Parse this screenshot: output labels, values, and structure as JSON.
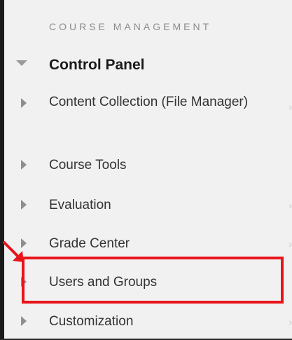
{
  "sidebar": {
    "section_heading": "COURSE MANAGEMENT",
    "control_panel_label": "Control Panel",
    "items": [
      {
        "label": "Content Collection (File Manager)",
        "has_chevron": true
      },
      {
        "label": "Course Tools",
        "has_chevron": false
      },
      {
        "label": "Evaluation",
        "has_chevron": true
      },
      {
        "label": "Grade Center",
        "has_chevron": true
      },
      {
        "label": "Users and Groups",
        "has_chevron": false,
        "highlighted": true
      },
      {
        "label": "Customization",
        "has_chevron": true
      }
    ],
    "chevron_glyph": "›"
  },
  "annotation": {
    "highlight_color": "#e8141b",
    "arrow_color": "#e8141b"
  },
  "colors": {
    "panel_bg": "#f1f1f1",
    "heading": "#8c8c8c",
    "text": "#333333"
  },
  "icons": {
    "expanded": "triangle-down-icon",
    "collapsed": "triangle-right-icon",
    "chevron": "chevron-right-icon"
  }
}
